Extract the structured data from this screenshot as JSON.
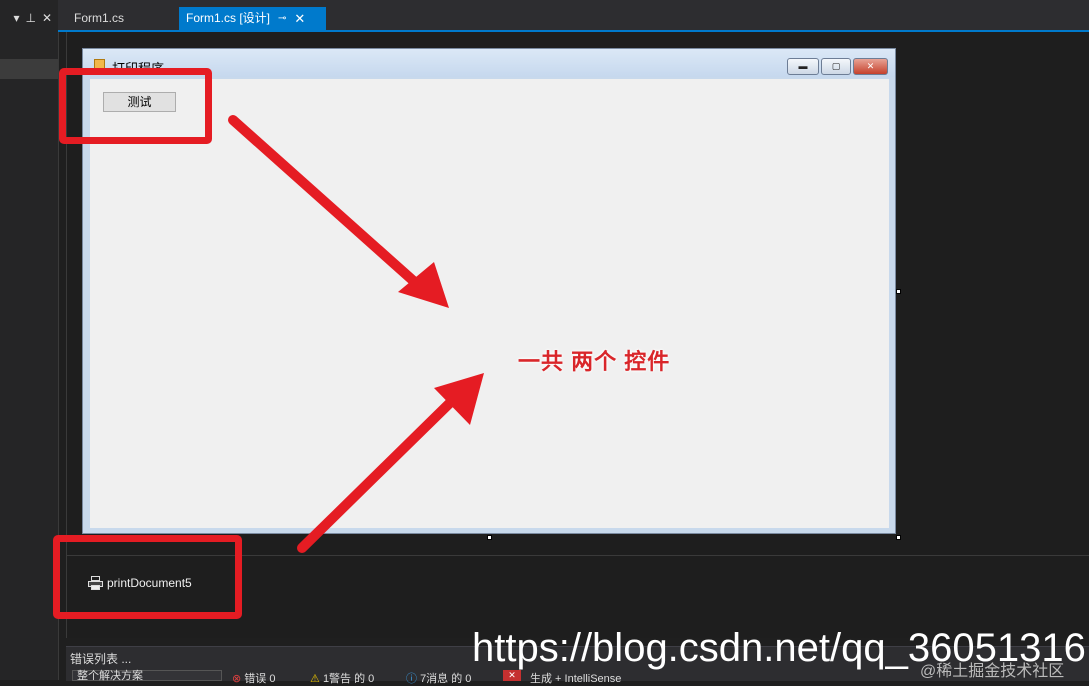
{
  "left_pane": {
    "pin_icon": "pin-icon",
    "close_label": "✕"
  },
  "tabs": [
    {
      "label": "Form1.cs"
    },
    {
      "label": "Form1.cs [设计]",
      "pin": "⊸",
      "close": "✕"
    }
  ],
  "form": {
    "title": "打印程序",
    "button_label": "测试"
  },
  "tray": {
    "component_label": "printDocument5"
  },
  "annotation": {
    "text": "一共 两个 控件",
    "color": "#e51c23"
  },
  "error_list": {
    "title": "错误列表 ...",
    "scope": "整个解决方案",
    "errors": "错误 0",
    "warnings": "1警告 的 0",
    "messages": "7消息 的 0",
    "build": "生成 + IntelliSense"
  },
  "watermark": {
    "url": "https://blog.csdn.net/qq_36051316",
    "source": "@稀土掘金技术社区"
  },
  "colors": {
    "accent": "#007acc",
    "background": "#1f1f1f"
  }
}
